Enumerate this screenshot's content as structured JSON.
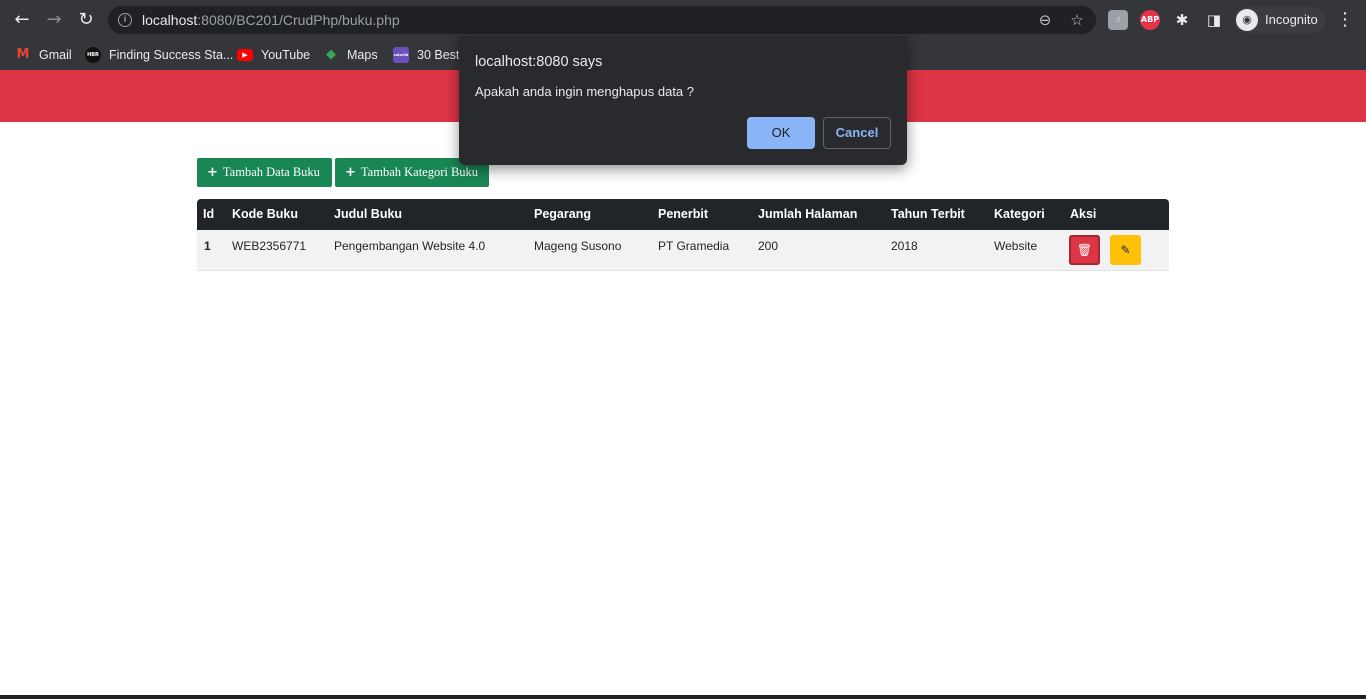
{
  "browser": {
    "url_host": "localhost",
    "url_rest": ":8080/BC201/CrudPhp/buku.php",
    "profile_label": "Incognito",
    "icons": {
      "back": "back-arrow-icon",
      "forward": "forward-arrow-icon",
      "reload": "reload-icon",
      "info": "info-icon",
      "zoom": "zoom-icon",
      "star": "bookmark-star-icon",
      "extensions": "puzzle-icon",
      "sidepanel": "side-panel-icon",
      "menu": "kebab-menu-icon"
    },
    "extensions": [
      "touch-extension-icon",
      "adblock-plus-icon"
    ],
    "adblock_text": "ABP"
  },
  "bookmarks": [
    {
      "label": "Gmail",
      "icon": "gmail-icon",
      "icon_text": "M",
      "color": "#ea4335"
    },
    {
      "label": "Finding Success Sta...",
      "icon": "hbr-icon",
      "icon_text": "HBR",
      "color": "#111111"
    },
    {
      "label": "YouTube",
      "icon": "youtube-icon",
      "icon_text": "▶",
      "color": "#ff0000"
    },
    {
      "label": "Maps",
      "icon": "maps-icon",
      "icon_text": "◆",
      "color": "#34a853"
    },
    {
      "label": "30 Best",
      "icon": "colorlib-icon",
      "icon_text": "colorlib",
      "color": "#6b4fbb"
    }
  ],
  "page": {
    "buttons": {
      "add_book": "Tambah Data Buku",
      "add_category": "Tambah Kategori Buku",
      "plus": "+"
    },
    "table": {
      "headers": [
        "Id",
        "Kode Buku",
        "Judul Buku",
        "Pegarang",
        "Penerbit",
        "Jumlah Halaman",
        "Tahun Terbit",
        "Kategori",
        "Aksi"
      ],
      "rows": [
        [
          "1",
          "WEB2356771",
          "Pengembangan Website 4.0",
          "Mageng Susono",
          "PT Gramedia",
          "200",
          "2018",
          "Website"
        ]
      ],
      "actions": {
        "delete": "trash-icon",
        "edit": "pencil-icon"
      }
    },
    "colors": {
      "header_band": "#dc3545",
      "button_green": "#198754",
      "table_head": "#212529",
      "delete": "#dc3545",
      "edit": "#ffc107"
    }
  },
  "dialog": {
    "title": "localhost:8080 says",
    "message": "Apakah anda ingin menghapus data ?",
    "ok": "OK",
    "cancel": "Cancel"
  }
}
